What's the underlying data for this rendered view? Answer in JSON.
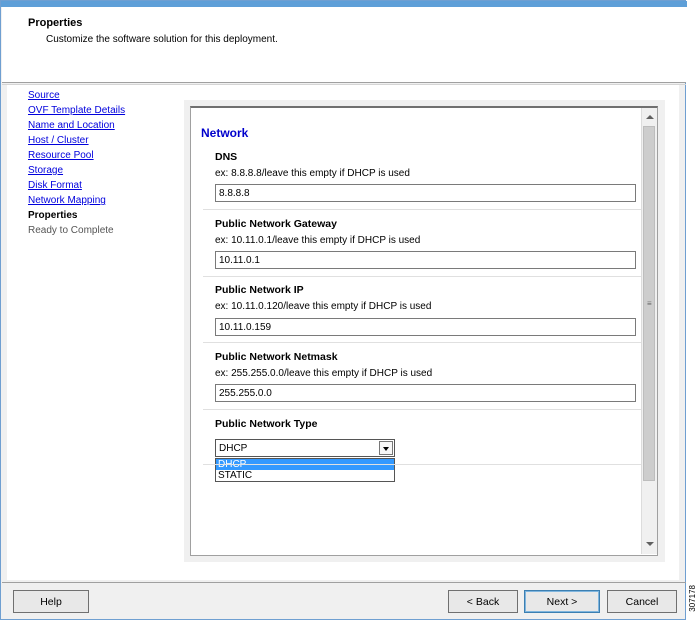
{
  "header": {
    "title": "Properties",
    "subtitle": "Customize the software solution for this deployment."
  },
  "nav": {
    "items": [
      {
        "label": "Source",
        "state": "link"
      },
      {
        "label": "OVF Template Details",
        "state": "link"
      },
      {
        "label": "Name and Location",
        "state": "link"
      },
      {
        "label": "Host / Cluster",
        "state": "link"
      },
      {
        "label": "Resource Pool",
        "state": "link"
      },
      {
        "label": "Storage",
        "state": "link"
      },
      {
        "label": "Disk Format",
        "state": "link"
      },
      {
        "label": "Network Mapping",
        "state": "link"
      },
      {
        "label": "Properties",
        "state": "current"
      },
      {
        "label": "Ready to Complete",
        "state": "pending"
      }
    ]
  },
  "form": {
    "section_title": "Network",
    "fields": [
      {
        "label": "DNS",
        "hint": "ex: 8.8.8.8/leave this empty if DHCP is used",
        "value": "8.8.8.8"
      },
      {
        "label": "Public Network Gateway",
        "hint": "ex: 10.11.0.1/leave this empty if DHCP is used",
        "value": "10.11.0.1"
      },
      {
        "label": "Public Network IP",
        "hint": "ex: 10.11.0.120/leave this empty if DHCP is used",
        "value": "10.11.0.159"
      },
      {
        "label": "Public Network Netmask",
        "hint": "ex: 255.255.0.0/leave this empty if DHCP is used",
        "value": "255.255.0.0"
      }
    ],
    "type_field": {
      "label": "Public Network Type",
      "selected": "DHCP",
      "options": [
        "DHCP",
        "STATIC"
      ]
    }
  },
  "buttons": {
    "help": "Help",
    "back": "< Back",
    "next": "Next >",
    "cancel": "Cancel"
  },
  "figure_id": "307178"
}
